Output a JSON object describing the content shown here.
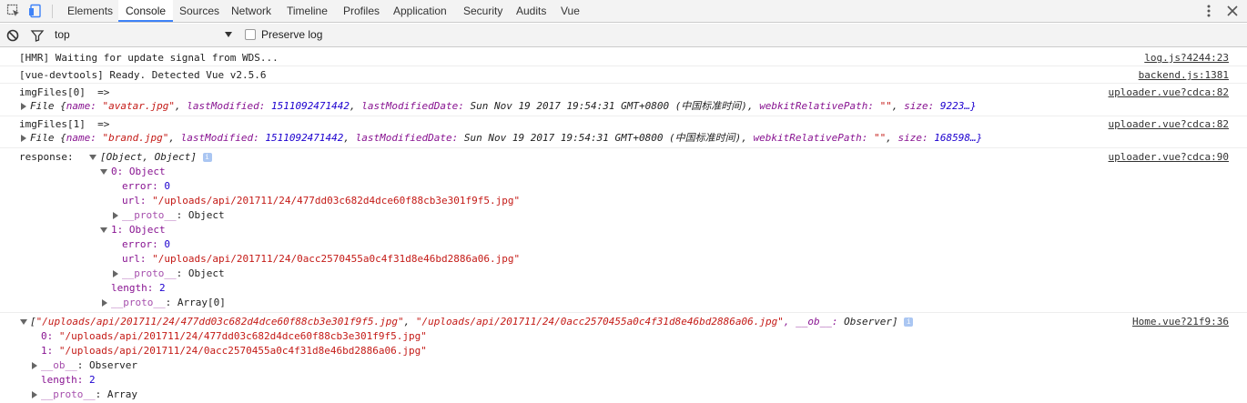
{
  "tabs": [
    {
      "label": "Elements"
    },
    {
      "label": "Console"
    },
    {
      "label": "Sources"
    },
    {
      "label": "Network"
    },
    {
      "label": "Timeline"
    },
    {
      "label": "Profiles"
    },
    {
      "label": "Application"
    },
    {
      "label": "Security"
    },
    {
      "label": "Audits"
    },
    {
      "label": "Vue"
    }
  ],
  "active_tab": "Console",
  "toolbar": {
    "context": "top",
    "preserve_log_label": "Preserve log",
    "preserve_log_checked": false
  },
  "messages": {
    "hmr": {
      "text": "[HMR] Waiting for update signal from WDS...",
      "source": "log.js?4244:23"
    },
    "devtools": {
      "text": "[vue-devtools] Ready. Detected Vue v2.5.6",
      "source": "backend.js:1381"
    },
    "img0": {
      "label": "imgFiles[0]  =>",
      "source": "uploader.vue?cdca:82",
      "prefix": "File {",
      "name_key": "name:",
      "name_val": "\"avatar.jpg\"",
      "lm_key": "lastModified:",
      "lm_val": "1511092471442",
      "lmd_key": "lastModifiedDate:",
      "lmd_val": "Sun Nov 19 2017 19:54:31 GMT+0800 (中国标准时间)",
      "wrp_key": "webkitRelativePath:",
      "wrp_val": "\"\"",
      "size_key": "size:",
      "size_val": "9223…}"
    },
    "img1": {
      "label": "imgFiles[1]  =>",
      "source": "uploader.vue?cdca:82",
      "prefix": "File {",
      "name_key": "name:",
      "name_val": "\"brand.jpg\"",
      "lm_key": "lastModified:",
      "lm_val": "1511092471442",
      "lmd_key": "lastModifiedDate:",
      "lmd_val": "Sun Nov 19 2017 19:54:31 GMT+0800 (中国标准时间)",
      "wrp_key": "webkitRelativePath:",
      "wrp_val": "\"\"",
      "size_key": "size:",
      "size_val": "168598…}"
    },
    "response": {
      "label": "response:",
      "summary": "[Object, Object]",
      "source": "uploader.vue?cdca:90",
      "item0_head": "0: Object",
      "item0_error_key": "error:",
      "item0_error_val": "0",
      "item0_url_key": "url:",
      "item0_url_val": "\"/uploads/api/201711/24/477dd03c682d4dce60f88cb3e301f9f5.jpg\"",
      "item0_proto_key": "__proto__",
      "item0_proto_val": ": Object",
      "item1_head": "1: Object",
      "item1_error_key": "error:",
      "item1_error_val": "0",
      "item1_url_key": "url:",
      "item1_url_val": "\"/uploads/api/201711/24/0acc2570455a0c4f31d8e46bd2886a06.jpg\"",
      "item1_proto_key": "__proto__",
      "item1_proto_val": ": Object",
      "length_key": "length:",
      "length_val": "2",
      "proto_key": "__proto__",
      "proto_val": ": Array[0]"
    },
    "home": {
      "summary_open": "[",
      "summary_s0": "\"/uploads/api/201711/24/477dd03c682d4dce60f88cb3e301f9f5.jpg\"",
      "summary_comma": ", ",
      "summary_s1": "\"/uploads/api/201711/24/0acc2570455a0c4f31d8e46bd2886a06.jpg\"",
      "summary_ob_key": ", __ob__:",
      "summary_ob_val": " Observer]",
      "source": "Home.vue?21f9:36",
      "item0_key": "0:",
      "item0_val": "\"/uploads/api/201711/24/477dd03c682d4dce60f88cb3e301f9f5.jpg\"",
      "item1_key": "1:",
      "item1_val": "\"/uploads/api/201711/24/0acc2570455a0c4f31d8e46bd2886a06.jpg\"",
      "ob_key": "__ob__",
      "ob_val": ": Observer",
      "length_key": "length:",
      "length_val": "2",
      "proto_key": "__proto__",
      "proto_val": ": Array"
    }
  },
  "colors": {
    "accent": "#3e82f7",
    "key": "#881391",
    "string": "#c41a16",
    "number": "#1c00cf"
  }
}
